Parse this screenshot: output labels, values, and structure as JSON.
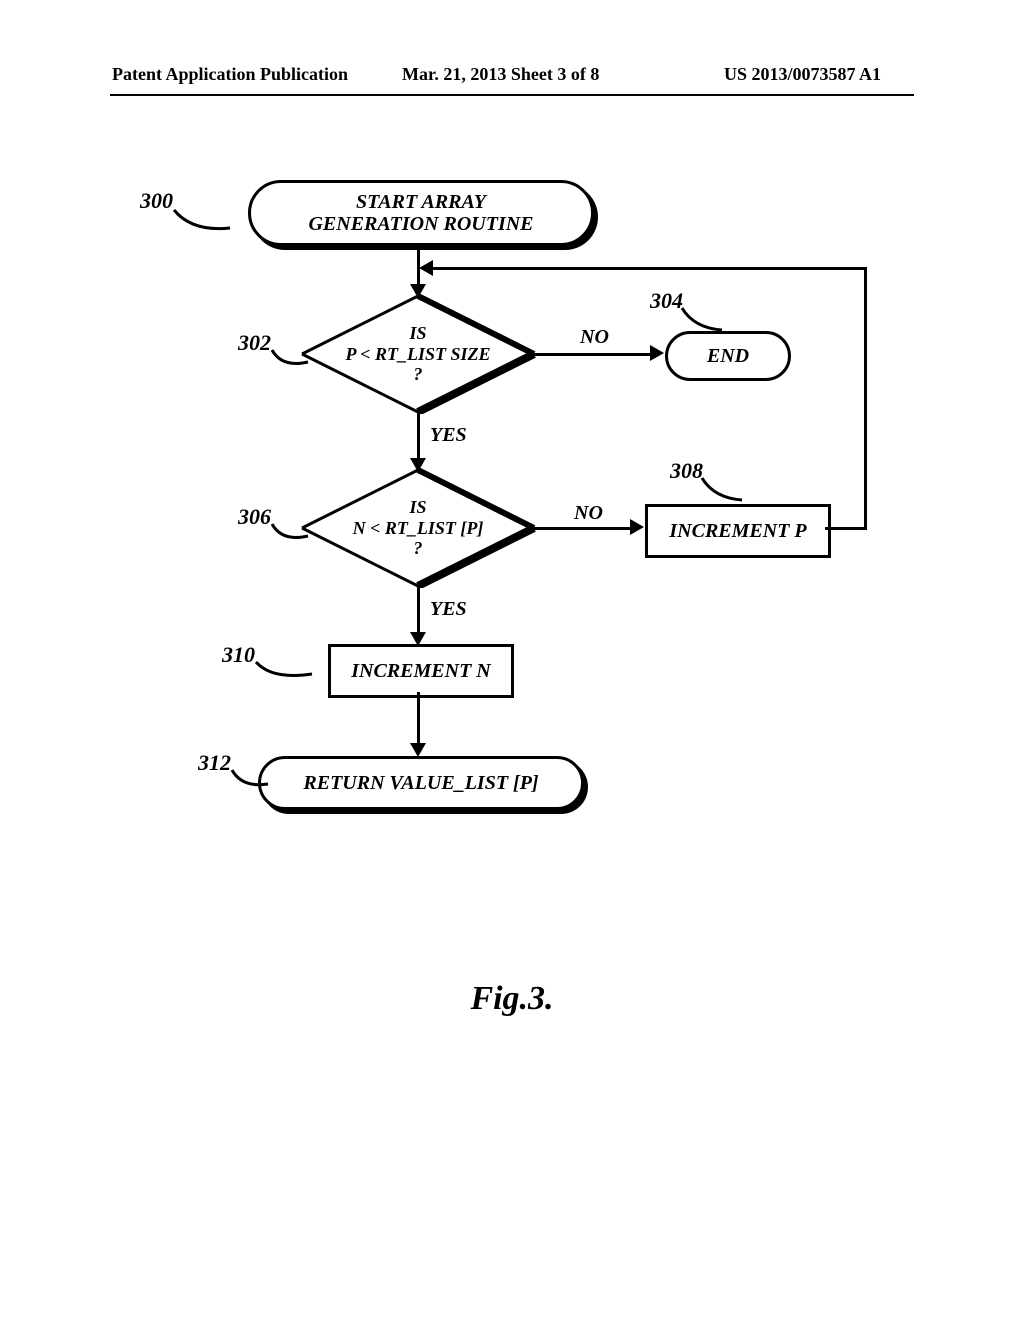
{
  "header": {
    "left": "Patent Application Publication",
    "center": "Mar. 21, 2013  Sheet 3 of 8",
    "right": "US 2013/0073587 A1"
  },
  "refs": {
    "r300": "300",
    "r302": "302",
    "r304": "304",
    "r306": "306",
    "r308": "308",
    "r310": "310",
    "r312": "312"
  },
  "shapes": {
    "start": "START ARRAY\nGENERATION ROUTINE",
    "dec302": "IS\nP < RT_LIST SIZE\n?",
    "end": "END",
    "dec306": "IS\nN < RT_LIST [P]\n?",
    "proc308": "INCREMENT P",
    "proc310": "INCREMENT N",
    "ret312": "RETURN VALUE_LIST [P]"
  },
  "edges": {
    "no": "NO",
    "yes": "YES"
  },
  "caption": "Fig.3."
}
